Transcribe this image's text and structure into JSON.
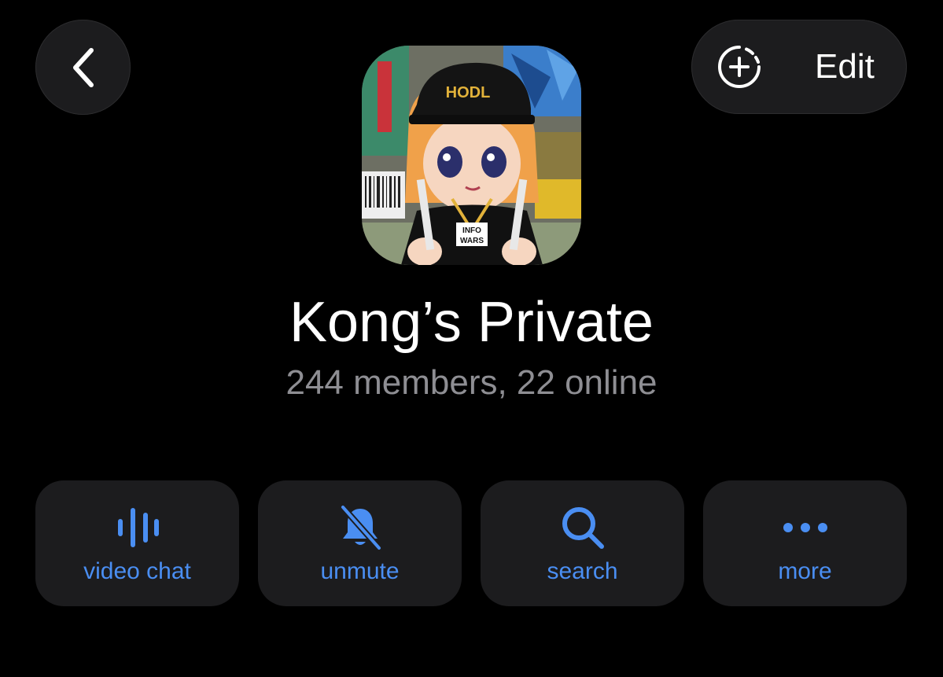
{
  "header": {
    "edit_label": "Edit"
  },
  "group": {
    "name": "Kong’s Private",
    "status": "244 members, 22 online"
  },
  "actions": [
    {
      "label": "video chat",
      "icon": "voice-wave-icon"
    },
    {
      "label": "unmute",
      "icon": "bell-slash-icon"
    },
    {
      "label": "search",
      "icon": "search-icon"
    },
    {
      "label": "more",
      "icon": "ellipsis-icon"
    }
  ],
  "colors": {
    "background": "#000000",
    "button_bg": "#1c1c1e",
    "accent": "#4a8ef2",
    "secondary_text": "#8e8e93"
  }
}
